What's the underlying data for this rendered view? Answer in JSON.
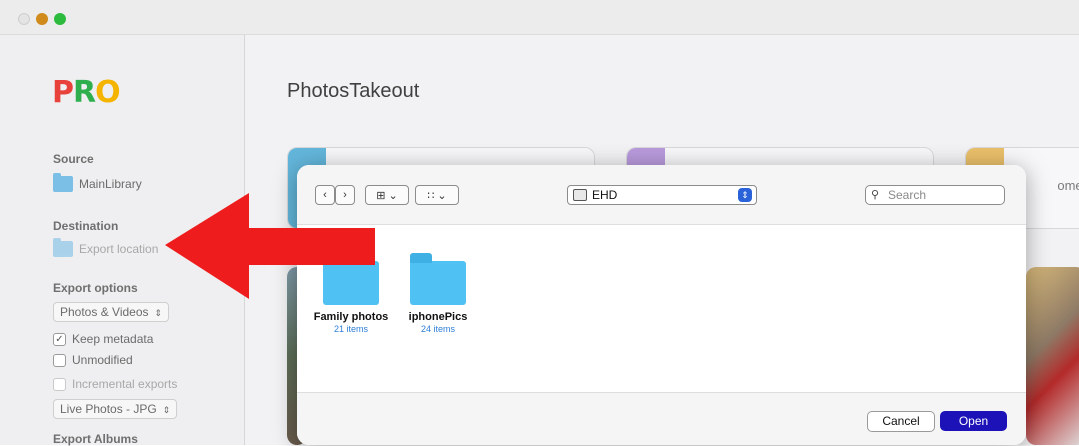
{
  "window": {
    "title": ""
  },
  "sidebar": {
    "logo_letters": [
      "P",
      "R",
      "O"
    ],
    "logo_colors": [
      "#e8403a",
      "#2fae4e",
      "#f4b400"
    ],
    "source_label": "Source",
    "source_item": "MainLibrary",
    "destination_label": "Destination",
    "destination_item": "Export location",
    "export_options_label": "Export options",
    "media_type_value": "Photos & Videos",
    "keep_metadata_label": "Keep metadata",
    "keep_metadata_checked": true,
    "unmodified_label": "Unmodified",
    "unmodified_checked": false,
    "incremental_label": "Incremental exports",
    "incremental_enabled": false,
    "live_photos_value": "Live Photos - JPG",
    "export_albums_label": "Export Albums"
  },
  "main": {
    "title": "PhotosTakeout",
    "cards": [
      {
        "accent": "#63b6db",
        "label": ""
      },
      {
        "accent": "#b89adc",
        "label": ""
      },
      {
        "accent": "#e9bf6a",
        "label": "oments"
      }
    ]
  },
  "dialog": {
    "back_glyph": "‹",
    "forward_glyph": "›",
    "view_icon_glyph": "⊞",
    "group_icon_glyph": "∷",
    "chevron_glyph": "⌄",
    "location_value": "EHD",
    "stepper_glyph": "⇕",
    "search_placeholder": "Search",
    "items": [
      {
        "name": "Family photos",
        "count": "21 items"
      },
      {
        "name": "iphonePics",
        "count": "24 items"
      }
    ],
    "cancel_label": "Cancel",
    "open_label": "Open",
    "open_color": "#1c12b8"
  },
  "annotation": {
    "arrow_color": "#ee1c1c",
    "arrow_direction": "left"
  }
}
